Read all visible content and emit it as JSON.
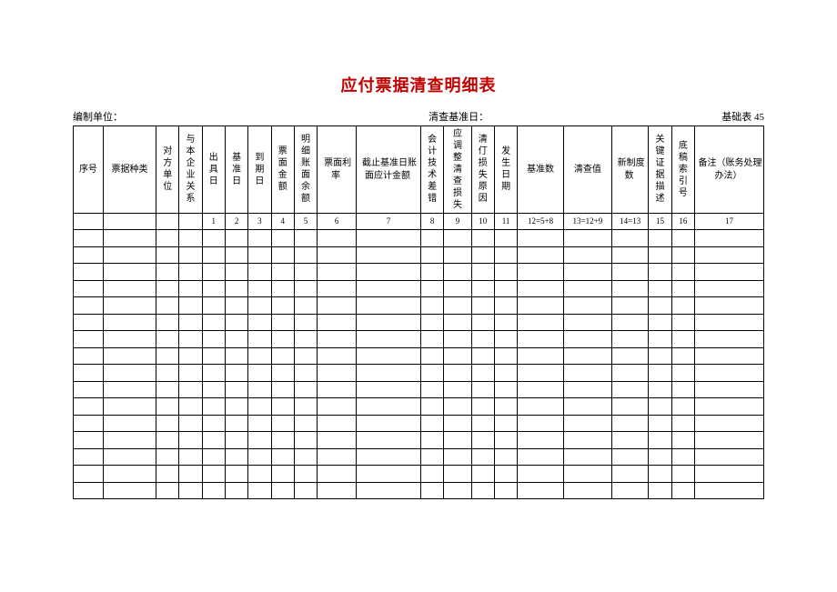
{
  "title": "应付票据清查明细表",
  "meta": {
    "left_label": "编制单位：",
    "center_label": "清查基准日：",
    "right_label": "基础表 45"
  },
  "columns": {
    "c1": "序号",
    "c2": "票据种类",
    "c3": "对方单位",
    "c4": "与本企业关系",
    "c5": "出具日",
    "c6": "基准日",
    "c7": "到期日",
    "c8": "票面金额",
    "c9": "明细账面余额",
    "c10": "票面利率",
    "c11": "截止基准日账面应计金额",
    "c12": "会计技术差错",
    "c13": "应调整清查损失",
    "c14": "清仃损失原因",
    "c15": "发生日期",
    "c16": "基准数",
    "c17": "清查值",
    "c18": "新制度数",
    "c19": "关键证据描述",
    "c20": "底稿索引号",
    "c21": "备注（账务处理办法）"
  },
  "formula": {
    "f5": "1",
    "f6": "2",
    "f7": "3",
    "f8": "4",
    "f9": "5",
    "f10": "6",
    "f11": "7",
    "f12": "8",
    "f13": "9",
    "f14": "10",
    "f15": "11",
    "f16": "12=5+8",
    "f17": "13=12+9",
    "f18": "14=13",
    "f19": "15",
    "f20": "16",
    "f21": "17"
  },
  "empty_rows": 16
}
